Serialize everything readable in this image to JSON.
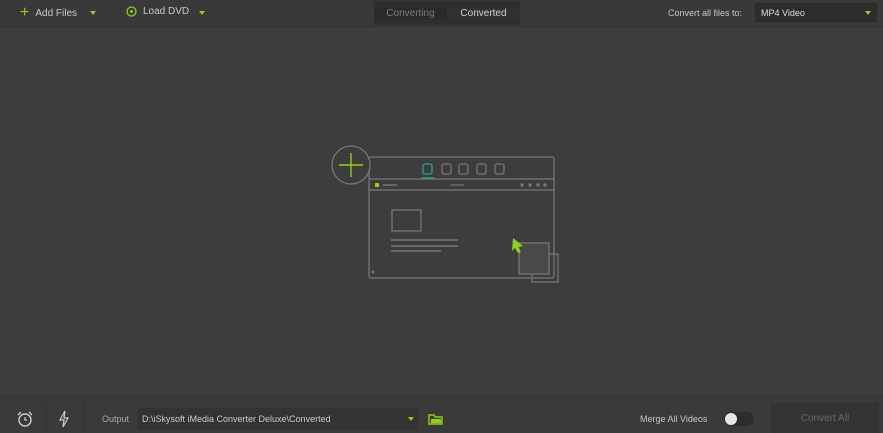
{
  "toolbar": {
    "add_files": "Add Files",
    "load_dvd": "Load DVD",
    "convert_all_label": "Convert all files to:",
    "format": "MP4 Video"
  },
  "tabs": [
    {
      "label": "Converting",
      "active": true
    },
    {
      "label": "Converted",
      "active": false
    }
  ],
  "footer": {
    "output_label": "Output",
    "output_path": "D:\\iSkysoft iMedia Converter Deluxe\\Converted",
    "merge_label": "Merge All Videos",
    "merge_on": false,
    "convert_all": "Convert All"
  },
  "colors": {
    "accent": "#8fd018",
    "teal": "#1aa88e"
  }
}
